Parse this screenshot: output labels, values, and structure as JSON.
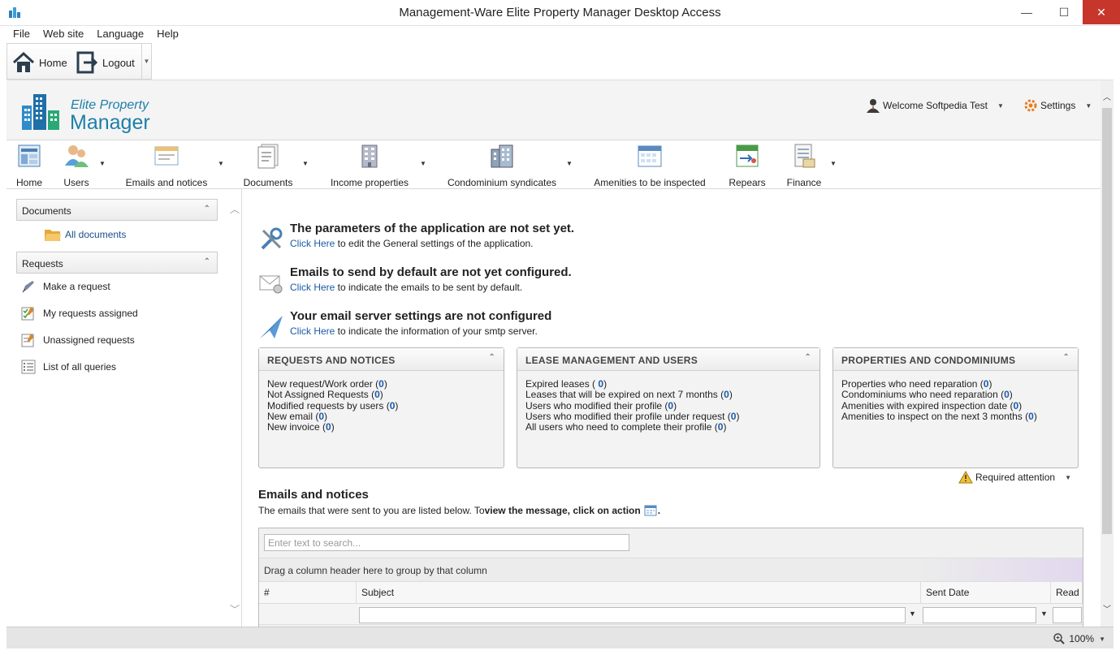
{
  "window": {
    "title": "Management-Ware Elite Property Manager Desktop Access",
    "minimize_glyph": "—",
    "maximize_glyph": "☐",
    "close_glyph": "✕"
  },
  "menu": [
    "File",
    "Web site",
    "Language",
    "Help"
  ],
  "toolbar": {
    "home_label": "Home",
    "logout_label": "Logout",
    "more_glyph": "▼"
  },
  "app_header": {
    "logo_line1": "Elite Property",
    "logo_line2": "Manager",
    "welcome_label": "Welcome Softpedia Test",
    "settings_label": "Settings",
    "caret": "▼"
  },
  "nav": {
    "home": "Home",
    "users": "Users",
    "emails": "Emails and notices",
    "documents": "Documents",
    "income": "Income properties",
    "condo": "Condominium syndicates",
    "amenities": "Amenities to be inspected",
    "repairs": "Repears",
    "finance": "Finance",
    "caret": "▼"
  },
  "sidebar": {
    "documents_header": "Documents",
    "all_documents": "All documents",
    "requests_header": "Requests",
    "make_request": "Make a request",
    "my_requests": "My requests assigned",
    "unassigned": "Unassigned requests",
    "list_all": "List of all queries",
    "chevron": "⌃",
    "scroll_up": "︿",
    "scroll_down": "﹀"
  },
  "notices": [
    {
      "title": "The parameters of the application are not set yet.",
      "link": "Click Here",
      "rest": " to edit the General settings of the application."
    },
    {
      "title": "Emails to send by default are not yet configured.",
      "link": "Click Here",
      "rest": " to indicate the emails to be sent by default."
    },
    {
      "title": "Your email server settings are not configured",
      "link": "Click Here",
      "rest": " to indicate the information of your smtp server."
    }
  ],
  "panels": {
    "requests": {
      "title": "REQUESTS AND NOTICES",
      "rows": [
        {
          "label": "New request/Work order (",
          "count": "0",
          "end": ")"
        },
        {
          "label": "Not Assigned Requests (",
          "count": "0",
          "end": ")"
        },
        {
          "label": "Modified requests by users (",
          "count": "0",
          "end": ")"
        },
        {
          "label": "New email (",
          "count": "0",
          "end": ")"
        },
        {
          "label": "New invoice (",
          "count": "0",
          "end": ")"
        }
      ]
    },
    "lease": {
      "title": "LEASE MANAGEMENT AND USERS",
      "rows": [
        {
          "label": "Expired leases ( ",
          "count": "0",
          "end": ")"
        },
        {
          "label": "Leases that will be expired on next 7 months (",
          "count": "0",
          "end": ")"
        },
        {
          "label": "Users who modified their profile (",
          "count": "0",
          "end": ")"
        },
        {
          "label": "Users who modified their profile under request (",
          "count": "0",
          "end": ")"
        },
        {
          "label": "All users who need to complete their profile (",
          "count": "0",
          "end": ")"
        }
      ]
    },
    "properties": {
      "title": "PROPERTIES AND CONDOMINIUMS",
      "rows": [
        {
          "label": "Properties who need reparation (",
          "count": "0",
          "end": ")"
        },
        {
          "label": "Condominiums who need reparation (",
          "count": "0",
          "end": ")"
        },
        {
          "label": "Amenities with expired inspection date (",
          "count": "0",
          "end": ")"
        },
        {
          "label": "Amenities to inspect on the next 3 months (",
          "count": "0",
          "end": ")"
        }
      ]
    }
  },
  "required_attention": "Required attention",
  "emails_section": {
    "title": "Emails and notices",
    "sub_plain": "The emails that were sent to you are listed below. To ",
    "sub_bold": "view the message, click on action",
    "sub_end": "."
  },
  "grid": {
    "search_placeholder": "Enter text to search...",
    "group_hint": "Drag a column header here to group by that column",
    "columns": [
      "#",
      "Subject",
      "Sent Date",
      "Read"
    ],
    "filter_glyph": "▼"
  },
  "status": {
    "zoom": "100%"
  },
  "colors": {
    "accent": "#1e7fa8",
    "link": "#1b5aa8",
    "close": "#c7362b"
  }
}
